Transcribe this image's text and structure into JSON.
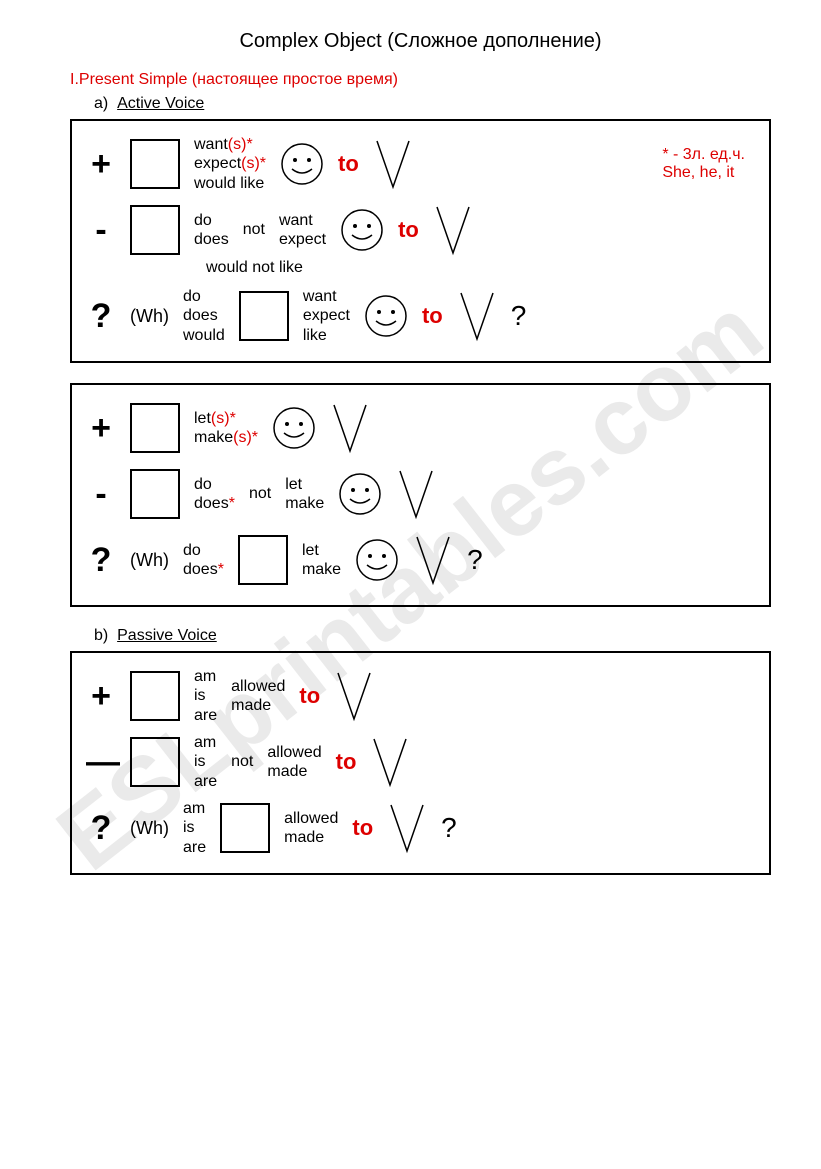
{
  "title": "Complex Object (Сложное дополнение)",
  "section1": {
    "num": "I.",
    "heading": "Present Simple (настоящее простое время)",
    "a_label": "a)",
    "a_text": "Active Voice",
    "b_label": "b)",
    "b_text": "Passive Voice"
  },
  "box1": {
    "plus": "+",
    "minus": "-",
    "q": "?",
    "wh": "(Wh)",
    "want": "want",
    "expect": "expect",
    "wouldlike": "would like",
    "s": "(s)*",
    "do": "do",
    "does": "does",
    "not": "not",
    "would": "would",
    "like": "like",
    "wouldnotlike": "would not like",
    "to": "to",
    "qmark": "?",
    "foot1": "* - 3л. ед.ч.",
    "foot2": "She, he, it"
  },
  "box2": {
    "plus": "+",
    "minus": "-",
    "q": "?",
    "wh": "(Wh)",
    "let": "let",
    "make": "make",
    "s": "(s)*",
    "do": "do",
    "does": "does",
    "star": "*",
    "not": "not",
    "qmark": "?"
  },
  "box3": {
    "plus": "+",
    "minus": "—",
    "q": "?",
    "wh": "(Wh)",
    "am": "am",
    "is": "is",
    "are": "are",
    "not": "not",
    "allowed": "allowed",
    "made": "made",
    "to": "to",
    "qmark": "?"
  },
  "watermark": "ESLprintables.com"
}
